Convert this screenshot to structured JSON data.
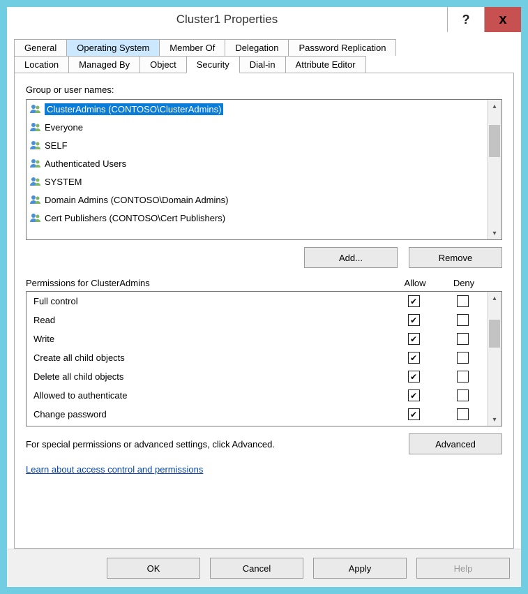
{
  "window": {
    "title": "Cluster1 Properties"
  },
  "titlebar": {
    "help": "?",
    "close": "x"
  },
  "tabs": {
    "row1": [
      "General",
      "Operating System",
      "Member Of",
      "Delegation",
      "Password Replication"
    ],
    "row1_highlight_index": 1,
    "row2": [
      "Location",
      "Managed By",
      "Object",
      "Security",
      "Dial-in",
      "Attribute Editor"
    ],
    "row2_active_index": 3
  },
  "security": {
    "group_label": "Group or user names:",
    "principals": [
      "ClusterAdmins (CONTOSO\\ClusterAdmins)",
      "Everyone",
      "SELF",
      "Authenticated Users",
      "SYSTEM",
      "Domain Admins (CONTOSO\\Domain Admins)",
      "Cert Publishers (CONTOSO\\Cert Publishers)"
    ],
    "selected_index": 0,
    "add_label": "Add...",
    "remove_label": "Remove",
    "perm_header": "Permissions for ClusterAdmins",
    "allow_label": "Allow",
    "deny_label": "Deny",
    "permissions": [
      {
        "name": "Full control",
        "allow": true,
        "deny": false
      },
      {
        "name": "Read",
        "allow": true,
        "deny": false
      },
      {
        "name": "Write",
        "allow": true,
        "deny": false
      },
      {
        "name": "Create all child objects",
        "allow": true,
        "deny": false
      },
      {
        "name": "Delete all child objects",
        "allow": true,
        "deny": false
      },
      {
        "name": "Allowed to authenticate",
        "allow": true,
        "deny": false
      },
      {
        "name": "Change password",
        "allow": true,
        "deny": false
      }
    ],
    "advanced_hint": "For special permissions or advanced settings, click Advanced.",
    "advanced_label": "Advanced",
    "learn_link": "Learn about access control and permissions"
  },
  "buttons": {
    "ok": "OK",
    "cancel": "Cancel",
    "apply": "Apply",
    "help": "Help"
  }
}
